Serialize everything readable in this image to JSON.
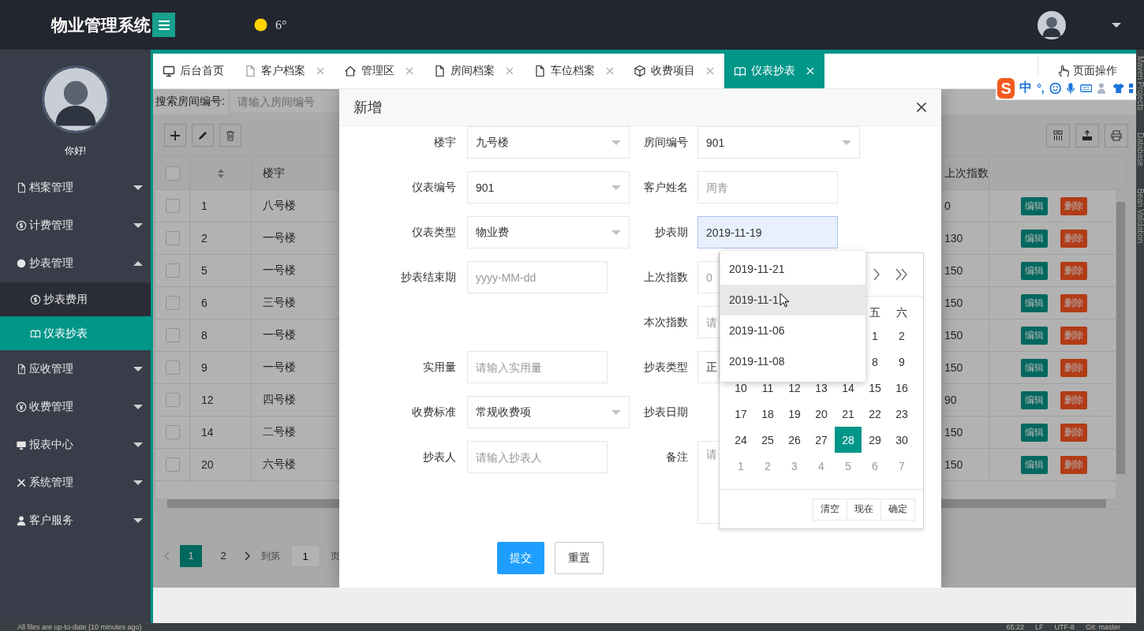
{
  "header": {
    "title": "物业管理系统",
    "temperature": "6°"
  },
  "sidebar": {
    "greeting": "你好!",
    "items": [
      {
        "label": "档案管理",
        "expanded": false,
        "selected": false
      },
      {
        "label": "计费管理",
        "expanded": false,
        "selected": false
      },
      {
        "label": "抄表管理",
        "expanded": true,
        "selected": false,
        "children": [
          {
            "label": "抄表费用",
            "selected": false
          },
          {
            "label": "仪表抄表",
            "selected": true
          }
        ]
      },
      {
        "label": "应收管理",
        "expanded": false,
        "selected": false
      },
      {
        "label": "收费管理",
        "expanded": false,
        "selected": false
      },
      {
        "label": "报表中心",
        "expanded": false,
        "selected": false
      },
      {
        "label": "系统管理",
        "expanded": false,
        "selected": false
      },
      {
        "label": "客户服务",
        "expanded": false,
        "selected": false
      }
    ]
  },
  "tabs": [
    {
      "label": "后台首页",
      "closable": false,
      "selected": false
    },
    {
      "label": "客户档案",
      "closable": true,
      "selected": false
    },
    {
      "label": "管理区",
      "closable": true,
      "selected": false
    },
    {
      "label": "房间档案",
      "closable": true,
      "selected": false
    },
    {
      "label": "车位档案",
      "closable": true,
      "selected": false
    },
    {
      "label": "收费项目",
      "closable": true,
      "selected": false
    },
    {
      "label": "仪表抄表",
      "closable": true,
      "selected": true
    }
  ],
  "page_actions": "页面操作",
  "ime_toolbar": {
    "logo": "S",
    "mode": "中",
    "punctuation": "°,"
  },
  "search": {
    "label": "搜索房间编号:",
    "placeholder": "请输入房间编号"
  },
  "table": {
    "all_checked": false,
    "columns": [
      {
        "label": "楼宇"
      },
      {
        "label": "上次指数"
      }
    ],
    "rows": [
      {
        "id": "1",
        "building": "八号楼",
        "last_reading": "0",
        "edit": "编辑",
        "delete": "删除",
        "checked": false
      },
      {
        "id": "2",
        "building": "一号楼",
        "last_reading": "130",
        "edit": "编辑",
        "delete": "删除",
        "checked": false
      },
      {
        "id": "5",
        "building": "一号楼",
        "last_reading": "150",
        "edit": "编辑",
        "delete": "删除",
        "checked": false
      },
      {
        "id": "6",
        "building": "三号楼",
        "last_reading": "150",
        "edit": "编辑",
        "delete": "删除",
        "checked": false
      },
      {
        "id": "8",
        "building": "一号楼",
        "last_reading": "150",
        "edit": "编辑",
        "delete": "删除",
        "checked": false
      },
      {
        "id": "9",
        "building": "一号楼",
        "last_reading": "150",
        "edit": "编辑",
        "delete": "删除",
        "checked": false
      },
      {
        "id": "12",
        "building": "四号楼",
        "last_reading": "90",
        "edit": "编辑",
        "delete": "删除",
        "checked": false
      },
      {
        "id": "14",
        "building": "二号楼",
        "last_reading": "150",
        "edit": "编辑",
        "delete": "删除",
        "checked": false
      },
      {
        "id": "20",
        "building": "六号楼",
        "last_reading": "150",
        "edit": "编辑",
        "delete": "删除",
        "checked": false
      }
    ]
  },
  "pagination": {
    "pages": [
      {
        "label": "1",
        "selected": true
      },
      {
        "label": "2",
        "selected": false
      }
    ],
    "goto_label": "到第",
    "goto_value": "1",
    "page_unit": "页"
  },
  "modal": {
    "title": "新增",
    "rows": [
      {
        "left": {
          "label": "楼宇",
          "kind": "select",
          "value": "九号楼",
          "focused": false
        },
        "right": {
          "label": "房间编号",
          "kind": "select",
          "value": "901",
          "focused": false
        }
      },
      {
        "left": {
          "label": "仪表编号",
          "kind": "select",
          "value": "901",
          "focused": false
        },
        "right": {
          "label": "客户姓名",
          "kind": "text",
          "placeholder": "周青",
          "focused": false
        }
      },
      {
        "left": {
          "label": "仪表类型",
          "kind": "select",
          "value": "物业费",
          "focused": false
        },
        "right": {
          "label": "抄表期",
          "kind": "text",
          "value": "2019-11-19",
          "focused": true
        }
      },
      {
        "left": {
          "label": "抄表结束期",
          "kind": "text",
          "placeholder": "yyyy-MM-dd",
          "focused": false
        },
        "right": {
          "label": "上次指数",
          "kind": "text",
          "placeholder": "0",
          "focused": false
        }
      },
      {
        "right": {
          "label": "本次指数",
          "kind": "text",
          "placeholder": "请",
          "focused": false
        }
      },
      {
        "left": {
          "label": "实用量",
          "kind": "text",
          "placeholder": "请输入实用量",
          "focused": false
        },
        "right": {
          "label": "抄表类型",
          "kind": "text",
          "value": "正",
          "focused": false
        }
      },
      {
        "left": {
          "label": "收费标准",
          "kind": "select",
          "value": "常规收费项",
          "focused": false
        },
        "right": {
          "label": "抄表日期"
        }
      },
      {
        "left": {
          "label": "抄表人",
          "kind": "text",
          "placeholder": "请输入抄表人",
          "focused": false
        },
        "right": {
          "label": "备注",
          "kind": "textarea",
          "placeholder": "请",
          "focused": false
        }
      }
    ],
    "buttons": [
      {
        "label": "提交",
        "kind": "primary"
      },
      {
        "label": "重置",
        "kind": "default"
      }
    ],
    "datepicker": {
      "weekdays": [
        "五",
        "六"
      ],
      "weeks": [
        {
          "days": [
            {
              "day": "1",
              "selected": false,
              "other_month": false
            },
            {
              "day": "2",
              "selected": false,
              "other_month": false
            }
          ]
        },
        {
          "days": [
            {
              "day": "8",
              "selected": false,
              "other_month": false
            },
            {
              "day": "9",
              "selected": false,
              "other_month": false
            }
          ]
        },
        {
          "days": [
            {
              "day": "10",
              "selected": false,
              "other_month": false
            },
            {
              "day": "11",
              "selected": false,
              "other_month": false
            },
            {
              "day": "12",
              "selected": false,
              "other_month": false
            },
            {
              "day": "13",
              "selected": false,
              "other_month": false
            },
            {
              "day": "14",
              "selected": false,
              "other_month": false
            },
            {
              "day": "15",
              "selected": false,
              "other_month": false
            },
            {
              "day": "16",
              "selected": false,
              "other_month": false
            }
          ]
        },
        {
          "days": [
            {
              "day": "17",
              "selected": false,
              "other_month": false
            },
            {
              "day": "18",
              "selected": false,
              "other_month": false
            },
            {
              "day": "19",
              "selected": false,
              "other_month": false
            },
            {
              "day": "20",
              "selected": false,
              "other_month": false
            },
            {
              "day": "21",
              "selected": false,
              "other_month": false
            },
            {
              "day": "22",
              "selected": false,
              "other_month": false
            },
            {
              "day": "23",
              "selected": false,
              "other_month": false
            }
          ]
        },
        {
          "days": [
            {
              "day": "24",
              "selected": false,
              "other_month": false
            },
            {
              "day": "25",
              "selected": false,
              "other_month": false
            },
            {
              "day": "26",
              "selected": false,
              "other_month": false
            },
            {
              "day": "27",
              "selected": false,
              "other_month": false
            },
            {
              "day": "28",
              "selected": true,
              "other_month": false
            },
            {
              "day": "29",
              "selected": false,
              "other_month": false
            },
            {
              "day": "30",
              "selected": false,
              "other_month": false
            }
          ]
        },
        {
          "days": [
            {
              "day": "1",
              "selected": false,
              "other_month": true
            },
            {
              "day": "2",
              "selected": false,
              "other_month": true
            },
            {
              "day": "3",
              "selected": false,
              "other_month": true
            },
            {
              "day": "4",
              "selected": false,
              "other_month": true
            },
            {
              "day": "5",
              "selected": false,
              "other_month": true
            },
            {
              "day": "6",
              "selected": false,
              "other_month": true
            },
            {
              "day": "7",
              "selected": false,
              "other_month": true
            }
          ]
        }
      ],
      "footer_buttons": [
        "清空",
        "现在",
        "确定"
      ]
    },
    "date_suggestions": [
      {
        "label": "2019-11-21",
        "selected": false
      },
      {
        "label": "2019-11-1",
        "selected": true
      },
      {
        "label": "2019-11-06",
        "selected": false
      },
      {
        "label": "2019-11-08",
        "selected": false
      }
    ]
  },
  "ide_strip": [
    "Maven Projects",
    "Database",
    "Bean Validation"
  ],
  "status_bar": {
    "message": "All files are up-to-date (10 minutes ago)",
    "position": "65:22",
    "line_ending": "LF",
    "encoding": "UTF-8",
    "branch": "Git: master"
  }
}
